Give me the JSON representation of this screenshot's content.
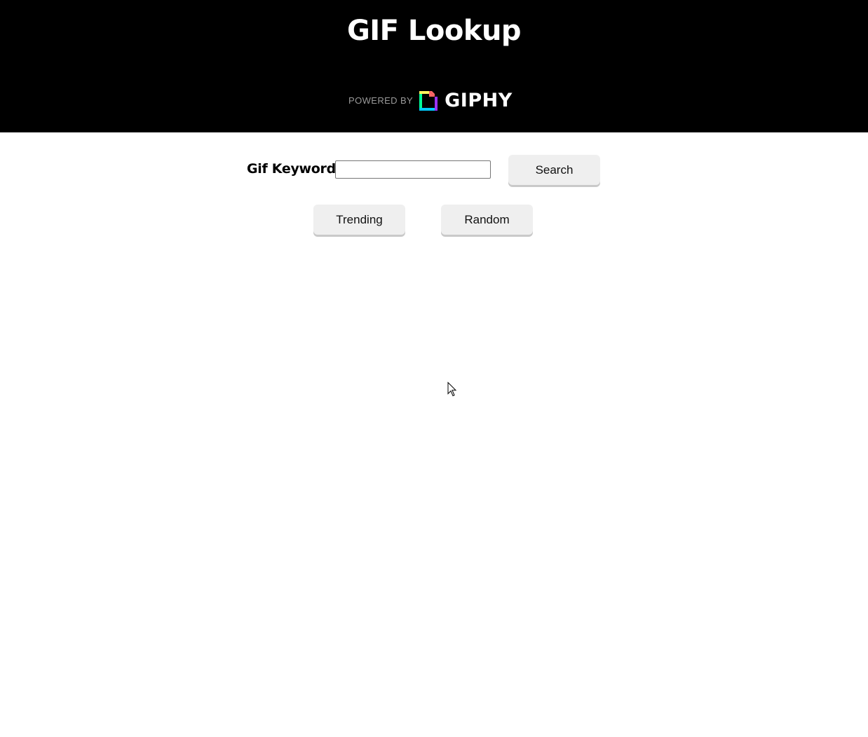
{
  "header": {
    "title": "GIF Lookup",
    "powered_by": "POWERED BY",
    "brand": "GIPHY"
  },
  "search": {
    "label": "Gif Keyword:",
    "value": "",
    "placeholder": "",
    "button_label": "Search"
  },
  "actions": {
    "trending_label": "Trending",
    "random_label": "Random"
  },
  "colors": {
    "header_bg": "#000000",
    "page_bg": "#ffffff",
    "button_bg": "#efefef",
    "logo_green": "#00ff99",
    "logo_blue": "#00ccff",
    "logo_purple": "#9933ff",
    "logo_pink": "#ff6666",
    "logo_yellow": "#fff35c"
  },
  "icons": {
    "logo": "giphy-logo-icon",
    "cursor": "mouse-pointer-icon"
  }
}
